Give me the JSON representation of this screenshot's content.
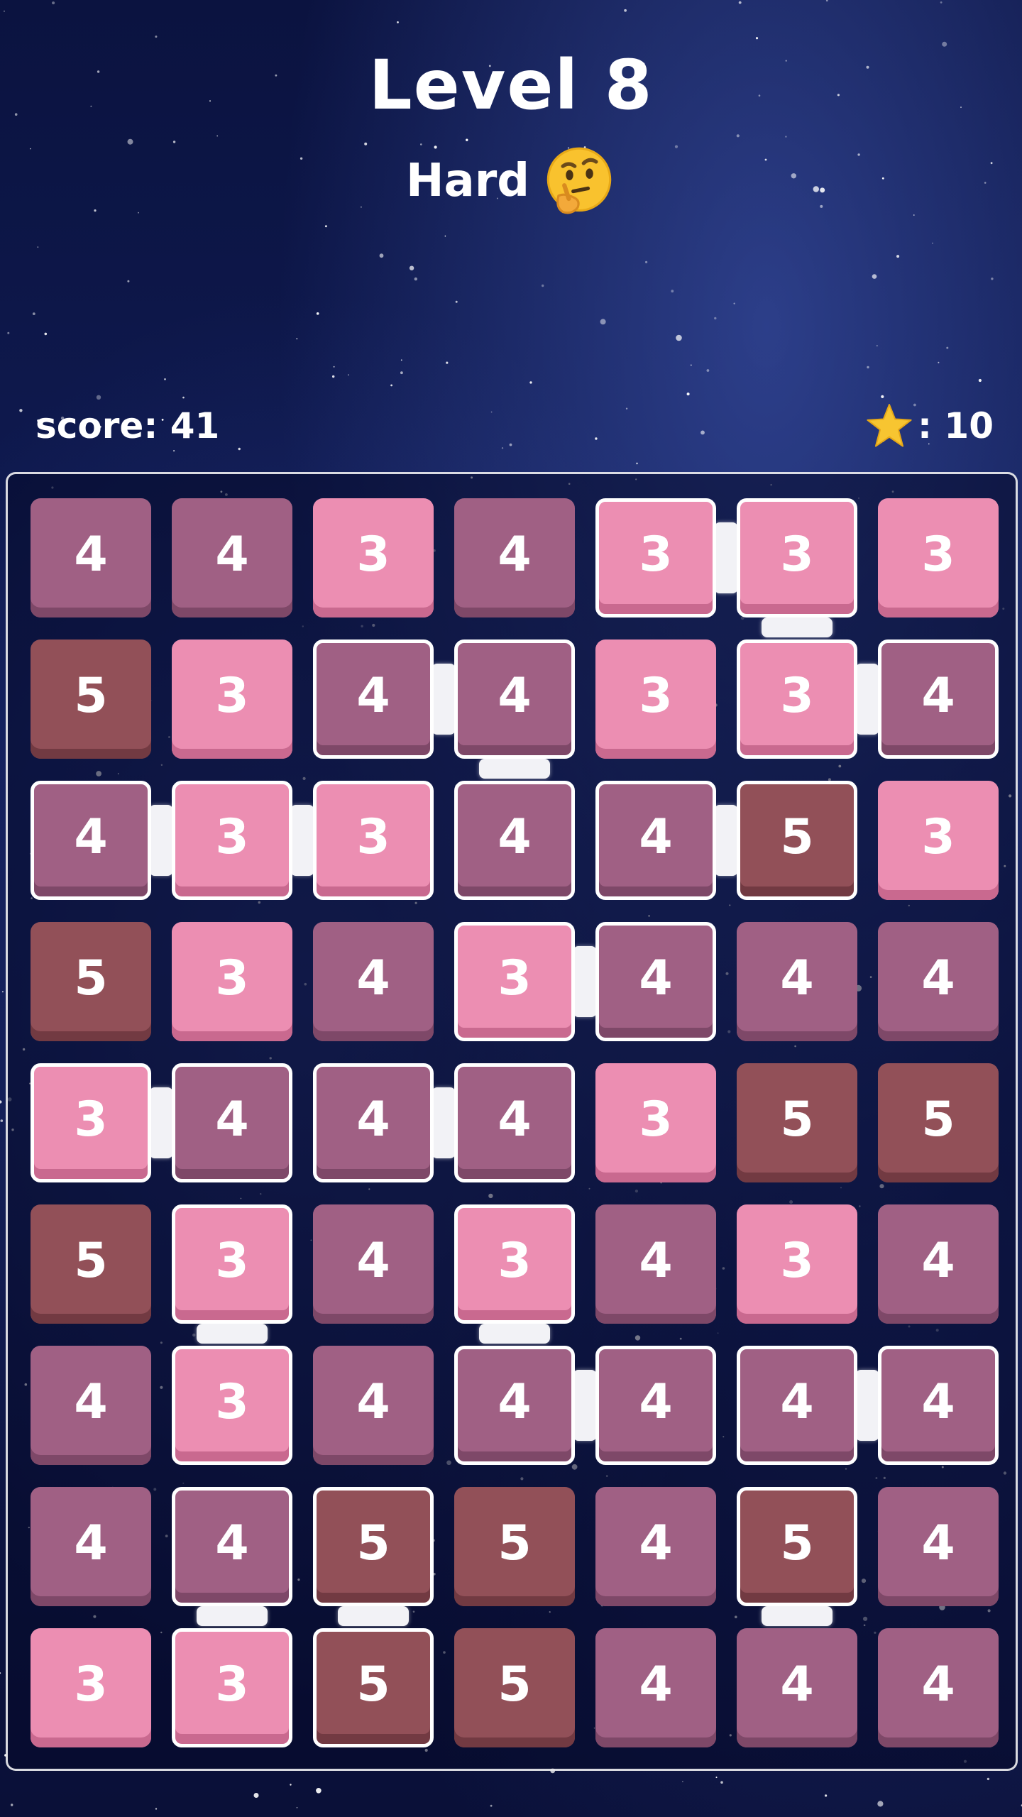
{
  "header": {
    "level_title": "Level 8",
    "difficulty": "Hard",
    "difficulty_icon": "thinking-face-icon"
  },
  "status": {
    "score_label": "score: 41",
    "stars_label": ": 10",
    "star_icon": "star-icon",
    "star_color": "#f7c531"
  },
  "colors": {
    "tile_3": "#ec8eb2",
    "tile_4": "#a06084",
    "tile_5": "#925058",
    "link": "#f2f2f6"
  },
  "board": {
    "rows": [
      [
        4,
        4,
        3,
        4,
        3,
        3,
        3
      ],
      [
        5,
        3,
        4,
        4,
        3,
        3,
        4
      ],
      [
        4,
        3,
        3,
        4,
        4,
        5,
        3
      ],
      [
        5,
        3,
        4,
        3,
        4,
        4,
        4
      ],
      [
        3,
        4,
        4,
        4,
        3,
        5,
        5
      ],
      [
        5,
        3,
        4,
        3,
        4,
        3,
        4
      ],
      [
        4,
        3,
        4,
        4,
        4,
        4,
        4
      ],
      [
        4,
        4,
        5,
        5,
        4,
        5,
        4
      ],
      [
        3,
        3,
        5,
        5,
        4,
        4,
        4
      ]
    ],
    "selected": [
      [
        0,
        4
      ],
      [
        0,
        5
      ],
      [
        1,
        2
      ],
      [
        1,
        3
      ],
      [
        1,
        5
      ],
      [
        1,
        6
      ],
      [
        2,
        0
      ],
      [
        2,
        1
      ],
      [
        2,
        2
      ],
      [
        2,
        3
      ],
      [
        2,
        4
      ],
      [
        2,
        5
      ],
      [
        3,
        3
      ],
      [
        3,
        4
      ],
      [
        4,
        0
      ],
      [
        4,
        1
      ],
      [
        4,
        2
      ],
      [
        4,
        3
      ],
      [
        5,
        1
      ],
      [
        5,
        3
      ],
      [
        6,
        1
      ],
      [
        6,
        3
      ],
      [
        6,
        4
      ],
      [
        6,
        5
      ],
      [
        6,
        6
      ],
      [
        7,
        1
      ],
      [
        7,
        2
      ],
      [
        7,
        5
      ],
      [
        8,
        1
      ],
      [
        8,
        2
      ]
    ],
    "links": [
      [
        0,
        4,
        0,
        5
      ],
      [
        0,
        5,
        1,
        5
      ],
      [
        1,
        5,
        1,
        6
      ],
      [
        1,
        2,
        1,
        3
      ],
      [
        1,
        3,
        2,
        3
      ],
      [
        2,
        0,
        2,
        1
      ],
      [
        2,
        1,
        2,
        2
      ],
      [
        2,
        4,
        2,
        5
      ],
      [
        3,
        3,
        3,
        4
      ],
      [
        4,
        0,
        4,
        1
      ],
      [
        4,
        2,
        4,
        3
      ],
      [
        5,
        1,
        6,
        1
      ],
      [
        5,
        3,
        6,
        3
      ],
      [
        6,
        3,
        6,
        4
      ],
      [
        6,
        5,
        6,
        6
      ],
      [
        7,
        1,
        8,
        1
      ],
      [
        7,
        2,
        8,
        2
      ],
      [
        7,
        5,
        8,
        5
      ]
    ]
  }
}
